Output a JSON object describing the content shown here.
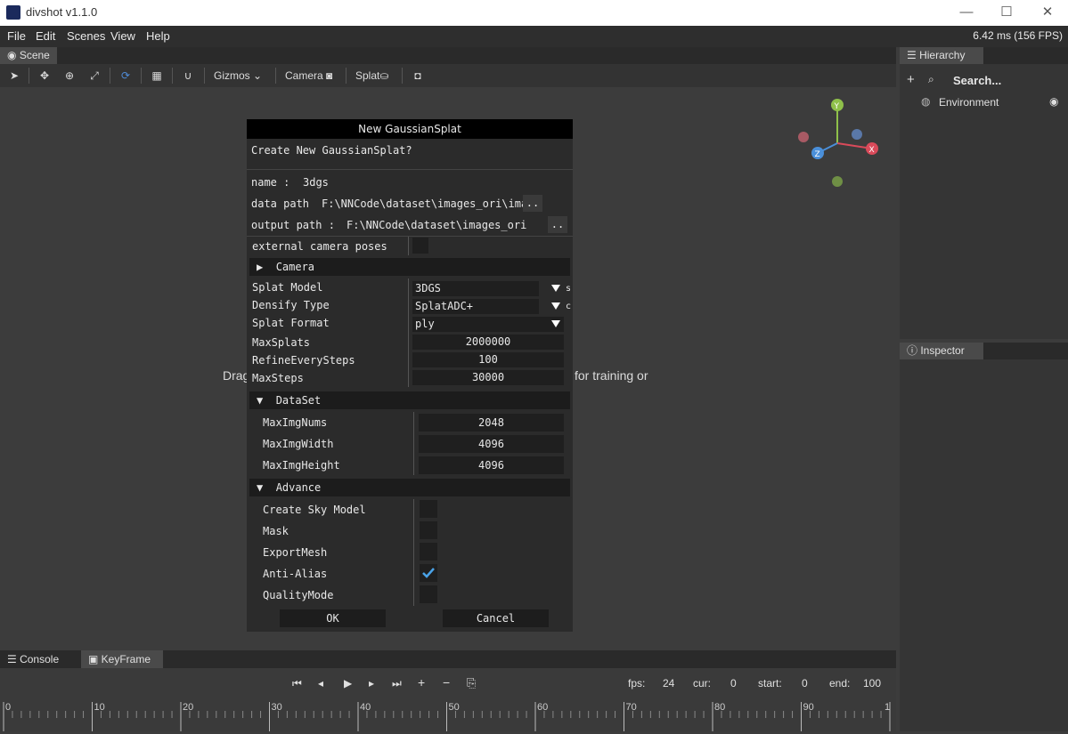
{
  "window": {
    "title": "divshot v1.1.0",
    "minimize": "—",
    "maximize": "☐",
    "close": "✕"
  },
  "menu": {
    "items": [
      "File",
      "Edit",
      "Scenes",
      "View",
      "Help"
    ],
    "fps": "6.42 ms (156 FPS)"
  },
  "scene_tab": "Scene",
  "toolbar": {
    "gizmos": "Gizmos",
    "camera": "Camera",
    "splat": "Splat"
  },
  "hierarchy": {
    "tab": "Hierarchy",
    "search": "Search...",
    "items": [
      "Environment"
    ]
  },
  "inspector": {
    "tab": "Inspector"
  },
  "viewport": {
    "drag_left": "Drag",
    "drag_right": "for training or"
  },
  "gizmo": {
    "y": "Y",
    "x": "X",
    "z": "Z"
  },
  "bottom_tabs": [
    "Console",
    "KeyFrame"
  ],
  "keyframe": {
    "fps_label": "fps:",
    "fps": "24",
    "cur_label": "cur:",
    "cur": "0",
    "start_label": "start:",
    "start": "0",
    "end_label": "end:",
    "end": "100"
  },
  "timeline": {
    "ticks": [
      "0",
      "10",
      "20",
      "30",
      "40",
      "50",
      "60",
      "70",
      "80",
      "90",
      "1"
    ]
  },
  "dialog": {
    "title": "New GaussianSplat",
    "question": "Create New GaussianSplat?",
    "name_label": "name :",
    "name_value": "3dgs",
    "data_path_label": "data path",
    "data_path_value": "F:\\NNCode\\dataset\\images_ori\\ima",
    "output_path_label": "output path :",
    "output_path_value": "F:\\NNCode\\dataset\\images_ori",
    "browse": "..",
    "external_camera_label": "external camera poses",
    "camera_header": "Camera",
    "splat_model_label": "Splat Model",
    "splat_model_value": "3DGS",
    "splat_model_suffix": "s",
    "densify_type_label": "Densify Type",
    "densify_type_value": "SplatADC+",
    "densify_type_suffix": "c",
    "splat_format_label": "Splat Format",
    "splat_format_value": "ply",
    "max_splats_label": "MaxSplats",
    "max_splats_value": "2000000",
    "refine_label": "RefineEverySteps",
    "refine_value": "100",
    "max_steps_label": "MaxSteps",
    "max_steps_value": "30000",
    "dataset_header": "DataSet",
    "max_img_nums_label": "MaxImgNums",
    "max_img_nums_value": "2048",
    "max_img_width_label": "MaxImgWidth",
    "max_img_width_value": "4096",
    "max_img_height_label": "MaxImgHeight",
    "max_img_height_value": "4096",
    "advance_header": "Advance",
    "sky_label": "Create Sky Model",
    "mask_label": "Mask",
    "export_mesh_label": "ExportMesh",
    "anti_alias_label": "Anti-Alias",
    "anti_alias_checked": true,
    "quality_label": "QualityMode",
    "ok": "OK",
    "cancel": "Cancel"
  }
}
